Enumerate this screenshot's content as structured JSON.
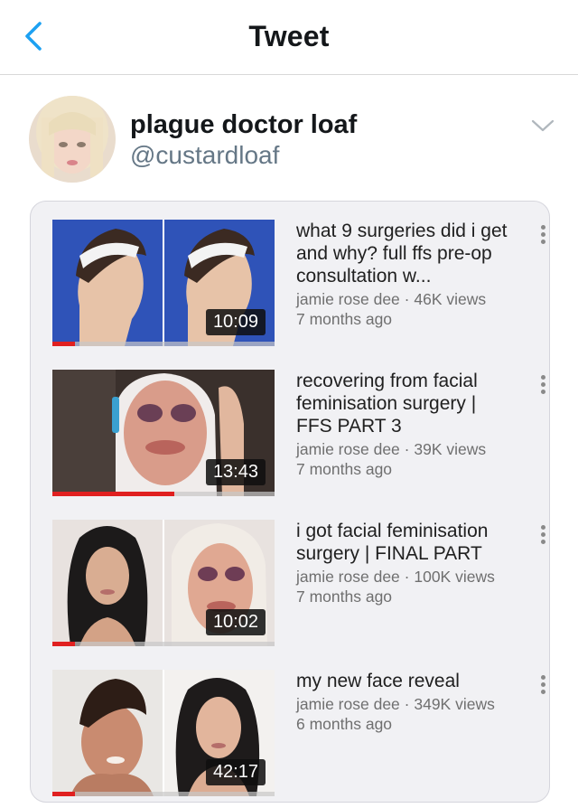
{
  "nav": {
    "title": "Tweet",
    "back_icon": "chevron-left-icon",
    "accent": "#1da1f2"
  },
  "author": {
    "display_name": "plague doctor loaf",
    "handle": "@custardloaf",
    "caret_icon": "chevron-down-icon"
  },
  "videos": [
    {
      "title": "what 9 surgeries did i get and why? full ffs pre-op consultation w...",
      "channel": "jamie rose dee",
      "views": "46K views",
      "age": "7 months ago",
      "duration": "10:09",
      "watched_fraction": 0.1
    },
    {
      "title": "recovering from facial feminisation surgery | FFS PART 3",
      "channel": "jamie rose dee",
      "views": "39K views",
      "age": "7 months ago",
      "duration": "13:43",
      "watched_fraction": 0.55
    },
    {
      "title": "i got facial feminisation surgery | FINAL PART",
      "channel": "jamie rose dee",
      "views": "100K views",
      "age": "7 months ago",
      "duration": "10:02",
      "watched_fraction": 0.1
    },
    {
      "title": "my new face reveal",
      "channel": "jamie rose dee",
      "views": "349K views",
      "age": "6 months ago",
      "duration": "42:17",
      "watched_fraction": 0.1
    }
  ],
  "meta_separator": " · "
}
